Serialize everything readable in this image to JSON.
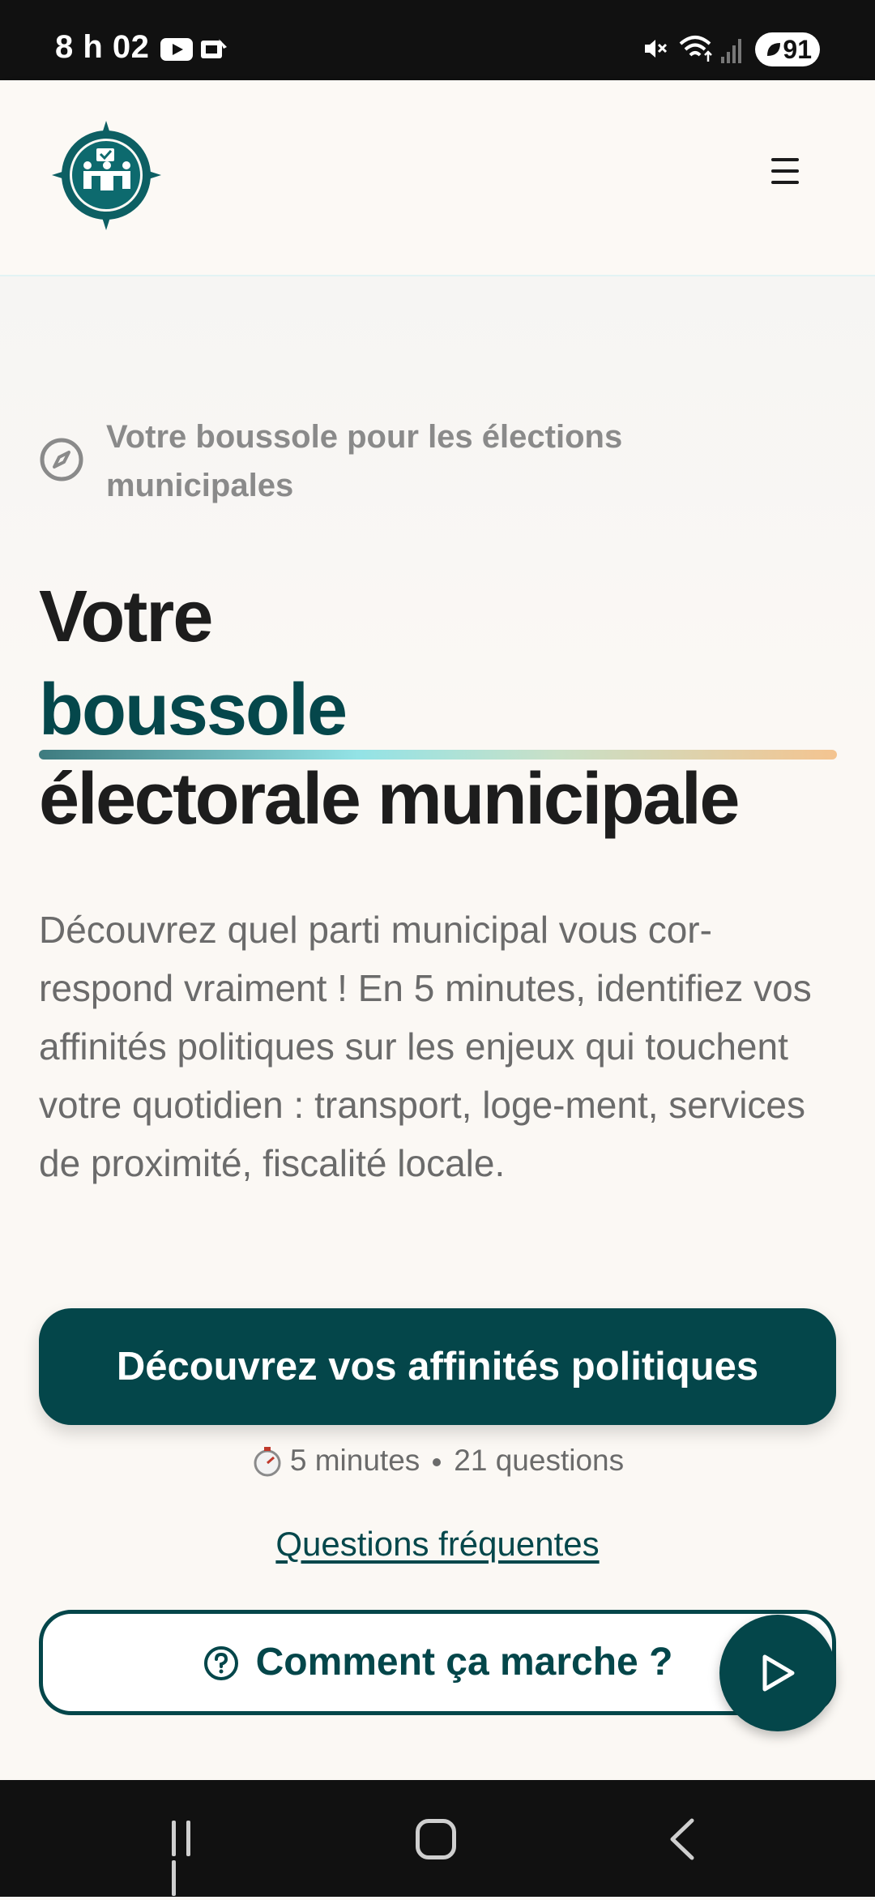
{
  "status_bar": {
    "time": "8 h 02",
    "battery": "91"
  },
  "header": {
    "logo_alt": "logo",
    "menu_icon": "hamburger-menu-icon"
  },
  "hero": {
    "tagline": "Votre boussole pour les élections municipales",
    "title_line1": "Votre",
    "title_line2": "boussole",
    "title_line3": "électorale municipale",
    "description": "Découvrez quel parti municipal vous cor-respond vraiment ! En 5 minutes, identifiez vos affinités politiques sur les enjeux qui touchent votre quotidien : transport, loge-ment, services de proximité, fiscalité locale.",
    "cta_label": "Découvrez vos affinités politiques",
    "meta_duration": "5 minutes",
    "meta_questions": "21 questions",
    "faq_link": "Questions fréquentes",
    "how_label": "Comment ça marche ?"
  },
  "colors": {
    "brand_dark": "#04464a",
    "text_dark": "#1d1d1d",
    "text_muted": "#6b6b6b",
    "background": "#fbf8f4"
  }
}
